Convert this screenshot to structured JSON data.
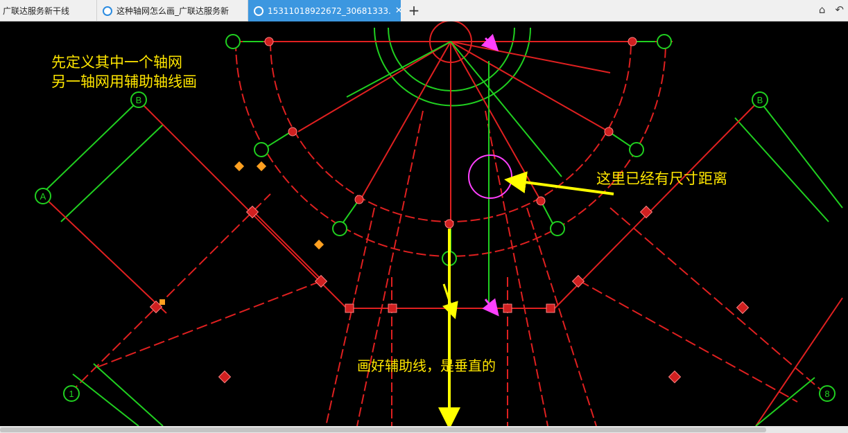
{
  "tabs": [
    {
      "label": "广联达服务新干线",
      "active": false
    },
    {
      "label": "这种轴网怎么画_广联达服务新",
      "active": false
    },
    {
      "label": "15311018922672_30681333.",
      "active": true
    }
  ],
  "new_tab_icon": "plus-icon",
  "toolbar_icons": [
    "favorites-icon",
    "undo-icon"
  ],
  "annotations": {
    "top_left_line1": "先定义其中一个轴网",
    "top_left_line2": "另一轴网用辅助轴线画",
    "right_note": "这里已经有尺寸距离",
    "bottom_note": "画好辅助线，是垂直的"
  },
  "axis_labels": {
    "A": "A",
    "B_left": "B",
    "B_right": "B",
    "one": "1",
    "eight": "8"
  },
  "colors": {
    "background": "#000000",
    "axis_line": "#ff2020",
    "grid_green": "#20d020",
    "annotation_text": "#ffe600",
    "arrow_yellow": "#ffff00",
    "highlight_magenta": "#ff40ff",
    "tab_active": "#3c97e0"
  }
}
